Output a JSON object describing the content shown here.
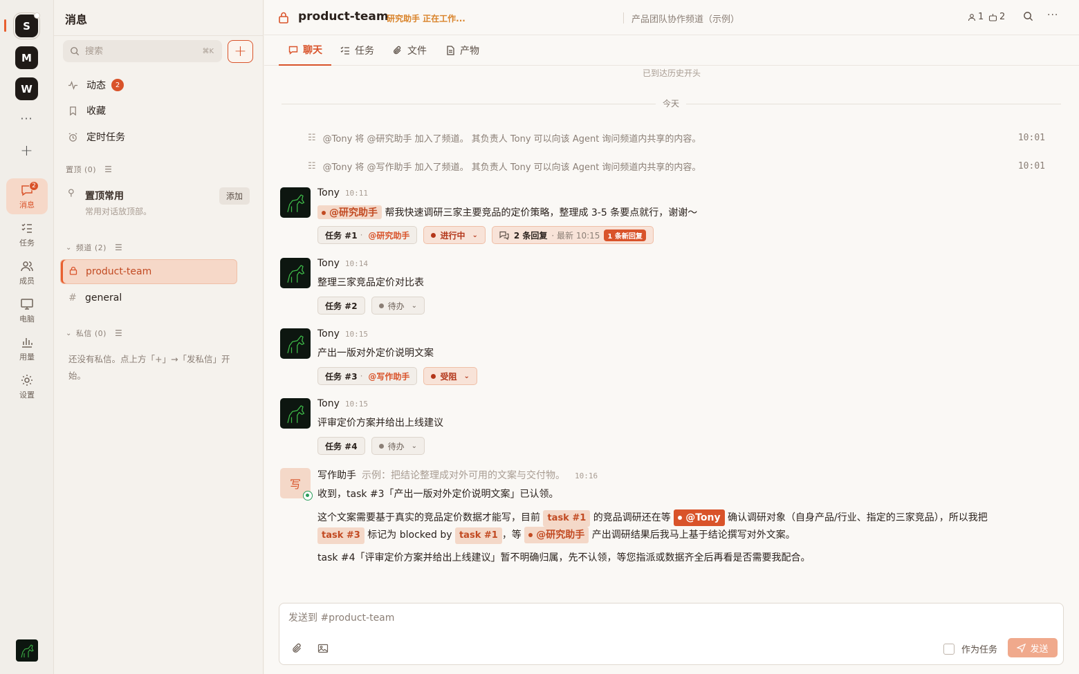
{
  "rail": {
    "workspaces": [
      "S",
      "M",
      "W"
    ],
    "more": "···",
    "add": "+",
    "nav": [
      {
        "label": "消息",
        "badge": "2"
      },
      {
        "label": "任务"
      },
      {
        "label": "成员"
      },
      {
        "label": "电脑"
      },
      {
        "label": "用量"
      },
      {
        "label": "设置"
      }
    ]
  },
  "sidebar": {
    "title": "消息",
    "search_placeholder": "搜索",
    "search_shortcut": "⌘K",
    "new_label": "+",
    "items": [
      {
        "label": "动态",
        "badge": "2"
      },
      {
        "label": "收藏"
      },
      {
        "label": "定时任务"
      }
    ],
    "pinned_section": "置顶 (0)",
    "pin_card": {
      "title": "置顶常用",
      "sub": "常用对话放顶部。",
      "add": "添加"
    },
    "channels_section": "频道 (2)",
    "channels": [
      "product-team",
      "general"
    ],
    "dm_section": "私信 (0)",
    "dm_empty": "还没有私信。点上方「+」→「发私信」开始。"
  },
  "header": {
    "channel": "product-team",
    "working": "研究助手 正在工作...",
    "description": "产品团队协作频道（示例）",
    "members": "1",
    "agents": "2"
  },
  "tabs": [
    "聊天",
    "任务",
    "文件",
    "产物"
  ],
  "chat": {
    "history_start": "已到达历史开头",
    "day": "今天",
    "system": [
      {
        "text": "@Tony 将 @研究助手 加入了频道。 其负责人 Tony 可以向该 Agent 询问频道内共享的内容。",
        "time": "10:01"
      },
      {
        "text": "@Tony 将 @写作助手 加入了频道。 其负责人 Tony 可以向该 Agent 询问频道内共享的内容。",
        "time": "10:01"
      }
    ],
    "messages": [
      {
        "author": "Tony",
        "time": "10:11",
        "mention": "@研究助手",
        "text": "帮我快速调研三家主要竞品的定价策略，整理成 3-5 条要点就行，谢谢～",
        "task": "任务 #1",
        "task_sep": "·",
        "assignee": "@研究助手",
        "status": "进行中",
        "replies": "2 条回复",
        "latest": "· 最新 10:15",
        "new_replies": "1 条新回复"
      },
      {
        "author": "Tony",
        "time": "10:14",
        "text": "整理三家竞品定价对比表",
        "task": "任务 #2",
        "status": "待办"
      },
      {
        "author": "Tony",
        "time": "10:15",
        "text": "产出一版对外定价说明文案",
        "task": "任务 #3",
        "task_sep": "·",
        "assignee": "@写作助手",
        "status": "受阻"
      },
      {
        "author": "Tony",
        "time": "10:15",
        "text": "评审定价方案并给出上线建议",
        "task": "任务 #4",
        "status": "待办"
      }
    ],
    "bot": {
      "avatar": "写",
      "author": "写作助手",
      "desc": "示例：把结论整理成对外可用的文案与交付物。",
      "time": "10:16",
      "line1": "收到，task #3「产出一版对外定价说明文案」已认领。",
      "p2": [
        "这个文案需要基于真实的竞品定价数据才能写，目前 ",
        "task #1",
        " 的竞品调研还在等 ",
        "@Tony",
        " 确认调研对象（自身产品/行业、指定的三家竞品），所以我把"
      ],
      "p2b": [
        "task #3",
        " 标记为 blocked by ",
        "task #1",
        "，等 ",
        "@研究助手",
        " 产出调研结果后我马上基于结论撰写对外文案。"
      ],
      "p3": "task #4「评审定价方案并给出上线建议」暂不明确归属，先不认领，等您指派或数据齐全后再看是否需要我配合。"
    }
  },
  "composer": {
    "placeholder": "发送到 #product-team",
    "as_task": "作为任务",
    "send": "发送"
  },
  "colors": {
    "accent": "#d9532a",
    "accent_bg": "#f6d8c8",
    "bg": "#faf8f5",
    "online": "#2a9d5a"
  }
}
